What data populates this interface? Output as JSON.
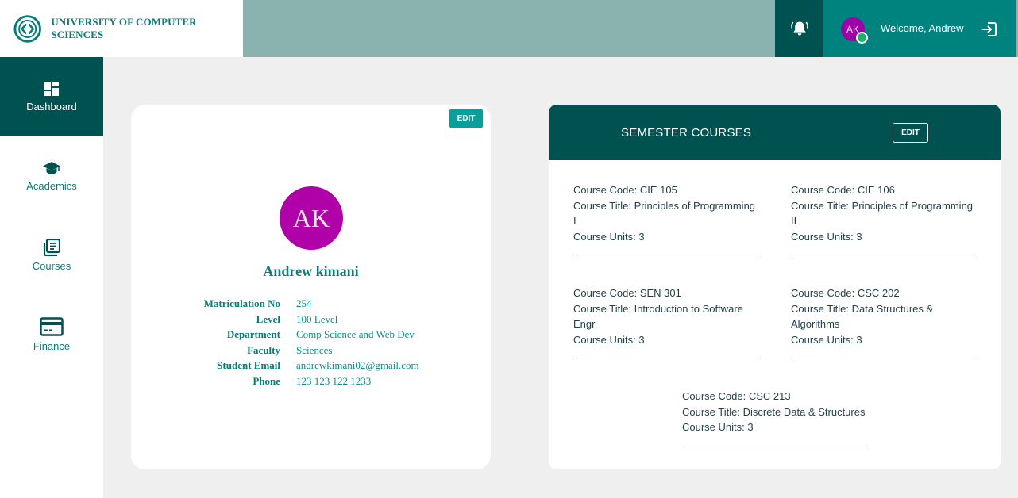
{
  "header": {
    "brand": "UNIVERSITY OF COMPUTER SCIENCES",
    "icons": {
      "logo": "code-brackets-logo",
      "bell": "bell-icon",
      "logout": "logout-icon"
    },
    "user_initials": "AK",
    "welcome": "Welcome, Andrew"
  },
  "sidebar": {
    "items": [
      {
        "label": "Dashboard",
        "icon": "dashboard-icon",
        "active": true
      },
      {
        "label": "Academics",
        "icon": "graduation-cap-icon",
        "active": false
      },
      {
        "label": "Courses",
        "icon": "books-icon",
        "active": false
      },
      {
        "label": "Finance",
        "icon": "credit-card-icon",
        "active": false
      }
    ]
  },
  "profile": {
    "edit_label": "EDIT",
    "initials": "AK",
    "name": "Andrew kimani",
    "fields": [
      {
        "label": "Matriculation No",
        "value": "254"
      },
      {
        "label": "Level",
        "value": "100 Level"
      },
      {
        "label": "Department",
        "value": "Comp Science and Web Dev"
      },
      {
        "label": "Faculty",
        "value": "Sciences"
      },
      {
        "label": "Student Email",
        "value": "andrewkimani02@gmail.com"
      },
      {
        "label": "Phone",
        "value": "123 123 122 1233"
      }
    ]
  },
  "courses": {
    "title": "SEMESTER COURSES",
    "edit_label": "EDIT",
    "items": [
      {
        "code": "Course Code: CIE 105",
        "title": "Course Title: Principles of Programming I",
        "units": "Course Units: 3"
      },
      {
        "code": "Course Code: CIE 106",
        "title": "Course Title: Principles of Programming II",
        "units": "Course Units: 3"
      },
      {
        "code": "Course Code: SEN 301",
        "title": "Course Title: Introduction to Software Engr",
        "units": "Course Units: 3"
      },
      {
        "code": "Course Code: CSC 202",
        "title": "Course Title: Data Structures & Algorithms",
        "units": "Course Units: 3"
      },
      {
        "code": "Course Code: CSC 213",
        "title": "Course Title: Discrete Data & Structures",
        "units": "Course Units: 3"
      }
    ]
  },
  "colors": {
    "primary_dark": "#005250",
    "primary": "#00837f",
    "header_bar": "#8ab2af",
    "accent_text": "#0a7b78",
    "avatar": "#b000a8",
    "online": "#1bb36a"
  }
}
